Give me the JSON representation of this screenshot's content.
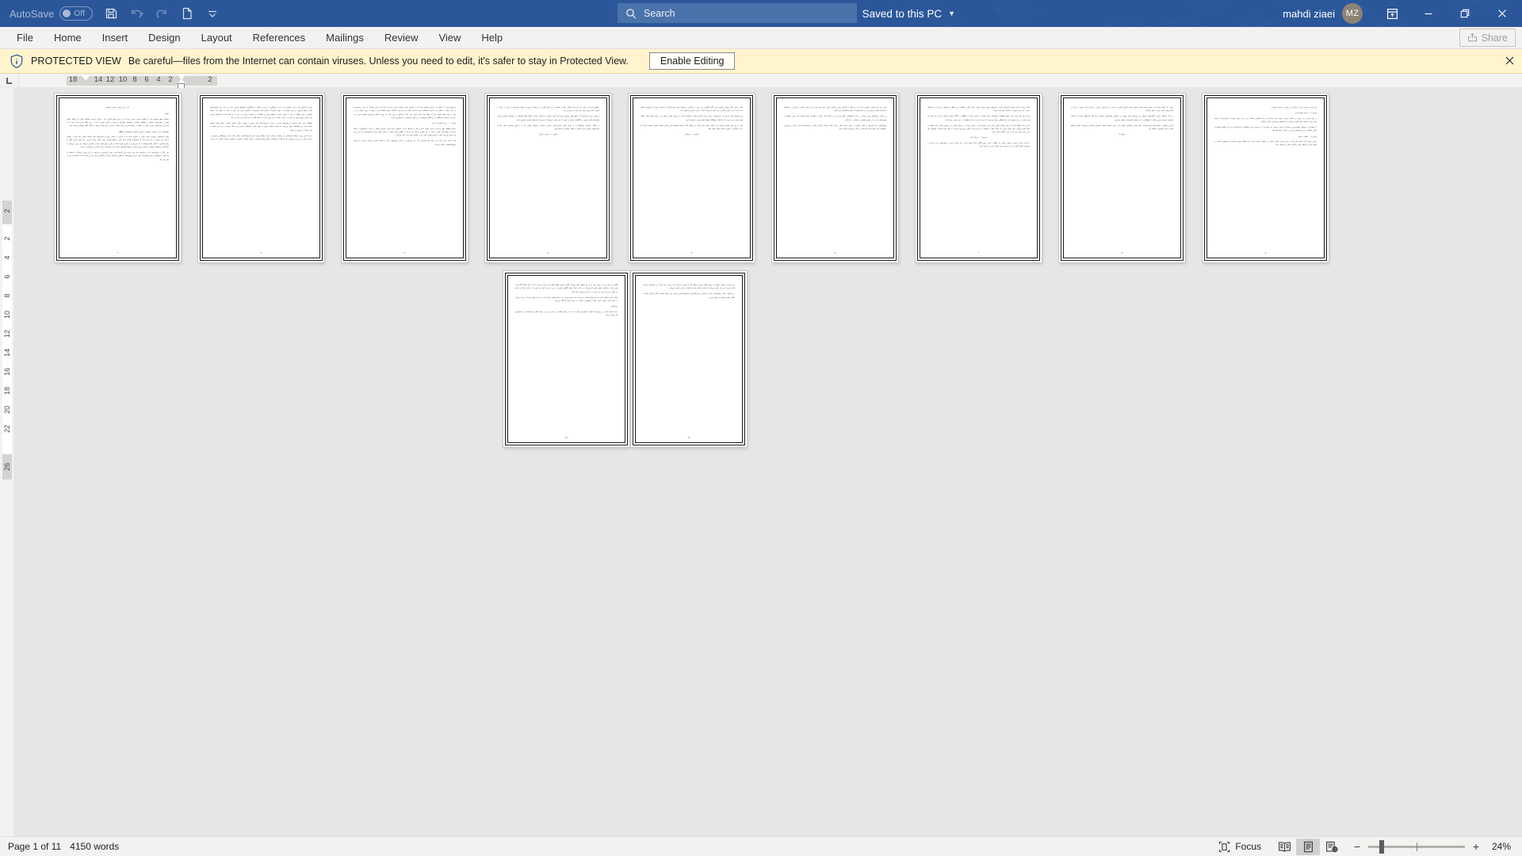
{
  "titlebar": {
    "autosave_label": "AutoSave",
    "autosave_state": "Off",
    "icons": {
      "save": "save-icon",
      "undo": "undo-icon",
      "redo": "redo-icon",
      "new": "new-document-icon",
      "customize": "customize-quick-access-toolbar-icon"
    },
    "document_name": "تازه ترین رویکرد درمانی اوتیسم",
    "separator1": "-",
    "protected_view_label": "Protected View",
    "separator2": "-",
    "saved_state": "Saved to this PC",
    "user_name": "mahdi ziaei",
    "user_initials": "MZ",
    "ribbon_display_icon": "ribbon-display-options-icon",
    "minimize_icon": "minimize-icon",
    "restore_icon": "restore-icon",
    "close_icon": "close-icon",
    "accent_color": "#2b579a"
  },
  "search": {
    "icon": "search-icon",
    "placeholder": "Search",
    "value": "Search"
  },
  "ribbon": {
    "tabs": [
      {
        "label": "File"
      },
      {
        "label": "Home"
      },
      {
        "label": "Insert"
      },
      {
        "label": "Design"
      },
      {
        "label": "Layout"
      },
      {
        "label": "References"
      },
      {
        "label": "Mailings"
      },
      {
        "label": "Review"
      },
      {
        "label": "View"
      },
      {
        "label": "Help"
      }
    ],
    "share_label": "Share",
    "share_icon": "share-icon",
    "share_disabled": true
  },
  "protected_view": {
    "icon": "shield-info-icon",
    "title": "PROTECTED VIEW",
    "message": "Be careful—files from the Internet can contain viruses. Unless you need to edit, it's safer to stay in Protected View.",
    "button_label": "Enable Editing",
    "close_icon": "close-icon",
    "background_color": "#fff4ce"
  },
  "ruler": {
    "tab_stop_label": "L",
    "horizontal_numbers": [
      "18",
      "14",
      "12",
      "10",
      "8",
      "6",
      "4",
      "2",
      "2"
    ],
    "vertical_numbers": [
      "2",
      "2",
      "4",
      "6",
      "8",
      "10",
      "12",
      "14",
      "16",
      "18",
      "20",
      "22",
      "26"
    ]
  },
  "status_bar": {
    "page_label": "Page 1 of 11",
    "word_count": "4150 words",
    "focus_label": "Focus",
    "focus_icon": "focus-mode-icon",
    "read_mode_icon": "read-mode-icon",
    "print_layout_icon": "print-layout-icon",
    "web_layout_icon": "web-layout-icon",
    "active_view": "print-layout",
    "zoom_out_label": "−",
    "zoom_in_label": "+",
    "zoom_percent": "24%"
  },
  "document": {
    "zoom": 24,
    "page_count": 11,
    "current_page": 1,
    "pages": [
      {
        "number": "1",
        "blocks": [
          {
            "style": "h",
            "text": "تازه ترین رویکرد درمانی اوتیسم"
          },
          {
            "style": "sec",
            "text": "چکیده:"
          },
          {
            "style": "p",
            "text": "اختلالات طیف اوتیسم یکی از اختلالات عصبی رشدی است که در سنین اولیه کودکی خود را نشان می‌دهد. مشکلات اصلی این اختلال شامل نقص در مهارت‌های ارتباطی و تعاملات اجتماعی، رفتارهای کلیشه‌ای و محدود و علایق تکراری است. در این مقاله سعی شده است که به تازه‌ترین رویکردهای درمانی مبتنی بر شواهد از روان‌شناسی و علوم اعصاب شناختی برای کودکان مبتلا به اختلال طیف اوتیسم پرداخته شود."
          },
          {
            "style": "sec",
            "text": "راهکارهای کار با کودکان اوتیسم از طریق مداخلات روانشناختی (ABA)"
          },
          {
            "style": "p",
            "text": "روش آنه‌سالیوان رویکردی علمی مبتنی بر یادگیری است که با تمرکز بر سنجش رفتار و توانایی‌های قابل توسعه، مسیر رشد کودک را هموار می‌کند. این رویکرد بر این باور است که رفتارهای کودکان قابل تغییر و اصلاح هستند. روش تحلیل رفتار کاربردی برای بهبود تمرکز، گفتار و رفتار کودکان با اختلال طیف اوتیسم به کار می‌رود و از طریق تقویت مثبت و تکرار، مهارت‌های جدید را آموزش می‌دهد. این روش می‌تواند به شکل‌گیری ارتباطات عمیق‌تر و پایدارتر میان کودک و محیط اطرافش کمک کند و زمینه‌ساز رشد شناختی و اجتماعی او باشد."
          },
          {
            "style": "p",
            "text": "یکی دیگر از رویکردهایی که در سال‌های اخیر مورد توجه قرار گرفته است، روش بازی‌درمانی می‌باشد. در این روش، درمانگر با استفاده از بازی‌های ساختاریافته و غیرساختاریافته سعی می‌کند مهارت‌های ارتباطی و تعاملی کودک را گسترش دهد و به او کمک کند تا احساسات خود را بهتر بیان کند."
          }
        ]
      },
      {
        "number": "2",
        "blocks": [
          {
            "style": "p",
            "text": "روش آنه‌سالیوان یک حرکت تخصصی است که با بهره‌گیری از حرکت و قصد در شکل‌گیری شبکه‌های عصبی، زمینه را برای رشد توانمندی‌های کودک فراهم می‌آورد. در مورد هم‌زمان به عنوان موجودات انسانی قادر می‌باشیم به یادگیری کردن حال مبتنی از افراد به عنوان یک سیستم مکانیکی یا این نیروگاه، از قرار به عنوان عوض و سیستم مبتنی بر اطلاعات به واسطه حرکات سر، این به این معنا است که پتانسیل انسانی برای تغییر و تغییر بهبود در تمرکز به مراتب بیشتر از آن چیزی است که قبلاً انتظار به این شکل پای بودن آن بود."
          },
          {
            "style": "p",
            "text": "مطالعات اخیر نشان داده‌اند که روش‌های مبتنی بر حرکت، می‌توانند تأثیر قابل توجهی بر کیفیت زندگی کودکان مبتلا به اختلال طیف اوتیسم داشته باشند. این مطالعات نشان می‌دهند که تمرینات منظم حرکتی به بهبود تعادل، هماهنگی و کنترل بدن کمک می‌کنند و در نتیجه اعتماد به نفس کودک را افزایش می‌دهند."
          },
          {
            "style": "p",
            "text": "در ارائه این روش توسط اندیشمندان در رابطه با کودکان دارای نیازهای ویژه، نتایج امیدوارکننده‌ای حاصل شده است. پژوهشگران بسیاری در سراسر جهان به بررسی اثربخشی این مداخلات پرداخته‌اند و گزارش‌های متعددی از بهبود عملکرد شناختی و اجتماعی کودکان منتشر شده است."
          }
        ]
      },
      {
        "number": "3",
        "blocks": [
          {
            "style": "p",
            "text": "و محیط است. آنه طیف یک حرکت تخصصی است که با کودکان دارای نیازهای خاص انجام داده است که عنوان کودکان از ترس و محدودیت در حال حرکت به معنای و از قدرت و تعاملات جدید شده‌اند، دیگر داخل کار یابد انشاالله نیروی هماهنگ کار در رابطه با روش اختلال سن در طی دو دهه شاهد تحولات کار آنه طیف بوده اینکه بسیار خود، نکات استدامها در این است که روش اختلالیه مبتدی‌ون منطقی خود برد و بخشی از آموزش دانشگاهی و برنامه‌های پژوهشی در پزشکی توانبخشی و فیزیوتراپی گردند."
          },
          {
            "style": "sec",
            "text": "مازوم ۱ — حرکت همراه با توجه"
          },
          {
            "style": "p",
            "text": "حرکت هماهنگ بهبود و قدرت زندگی انسان است و مغز به واسطه حرکت ساختمانی شده است. بنابراین مشکل به رشد و شکل‌گیری از کمک می‌کند در واقع مغز، تمامی حرکت را ساز ماهیتی می‌کند، اما حرکت به قطعی کافی نیست به عنوان مثال حرکت‌ هوشیارانه‌ای که چون توجه فرد انجام می‌شود یکجا از طریق مهارت هایی که در انگیزه وجود دارد ایجاد می‌گردد."
          },
          {
            "style": "p",
            "text": "مغز حرکت کردن علت می شود مغز تغییراتی یابد، این موضوع به ساختار نورون‌های جدید و ارتباط عصبی مربوط می‌شود که فرآیند نوروپلاستیسیتی نامیده می‌شود."
          }
        ]
      },
      {
        "number": "4",
        "blocks": [
          {
            "style": "p",
            "text": "راهنمایی است در مغز. ما قرار دهد کودکان مبتلا به اوتیسم را در نظر بگیرند، در رابطه با نوروز از منظر نورولوژیک و مبتنی بر رشد، از تأثیرات قابل روی تمرکز قابل توجه و بررسی دارد."
          },
          {
            "style": "p",
            "text": "مرحله‌ی سوم، مرحله‌ای که از مهارت‌های روزمره برای اجرا گردد. بسیاری از کودکان مبتلا به اختلال طیف اوتیسم، در سال‌های نخستین زندگی، تفاوت‌های قابل توجهی در الگوهای حرکتی و حسی از خود نشان می‌دهند که می‌تواند نشانه‌های اولیه‌ی تشخیص باشد."
          },
          {
            "style": "p",
            "text": "در مقابل، مداخلات زودهنگام که بر پایه‌ی اصول عصب‌شناختی طراحی شده‌اند، می‌توانند مسیر رشد را به طور معناداری تغییر دهند و فرصت‌های بیشتری برای یادگیری و تعامل اجتماعی فراهم آورند."
          },
          {
            "style": "ctr",
            "text": "مازوم ۲ — توجه و تمرکز"
          }
        ]
      },
      {
        "number": "5",
        "blocks": [
          {
            "style": "p",
            "text": "مغز در یکی دیگر نوعیات یادگیری است. نگاه یادگیری برای رشد و سازگاری در محیط است. مغز انسان از شبکه‌ای پیچیده از نورون‌ها تشکیل شده است که در طول زندگی و بر اساس تجربه‌ها، دائماً در حال بازسازی و تغییر است."
          },
          {
            "style": "p",
            "text": "این موضوع نشان می‌دهد که فرصت‌های درمانی برای کودکان مبتلا به اوتیسم محدود به دوره‌ی کودکی نیست و در تمام طول زندگی امکان بهبود وجود دارد، هرچند که مداخلات زودهنگام معمولاً نتایج بهتری به همراه دارند."
          },
          {
            "style": "p",
            "text": "آنچه در این میان اهمیت ویژه‌ای دارد، کیفیت تعامل میان کودک و درمانگر است. ارتباط عاطفی امن و قابل اعتماد، بستری فراهم می‌کند که در آن یادگیری به بهترین شکل ممکن اتفاق بیفتد."
          },
          {
            "style": "ctr",
            "text": "مازوم ۳ — یادگیری"
          }
        ]
      },
      {
        "number": "6",
        "blocks": [
          {
            "style": "p",
            "text": "مغز برای این نوعیات یادگیری است که در رابطه با کودکان دارای نیازهای خاص انجام داده است. این نکته‌ی کلیدی در طراحی برنامه‌های مداخله‌ای اهمیت فراوان دارد و باید همواره مد نظر متخصصان قرار گیرد."
          },
          {
            "style": "p",
            "text": "در نتیجه، رویکردهای نوین درمانی بر ایجاد محیط‌هایی تأکید دارند که در آن‌ها کودک بتواند با اطمینان خاطر کاوش کند، تجربه بیاموزد و مهارت‌های تازه را در بستری طبیعی و معنادار به کار گیرد."
          },
          {
            "style": "p",
            "text": "پژوهش‌های جدید همچنین بر نقش خانواده به عنوان شریک اصلی درمان تأکید می‌کنند. آموزش والدین و توانمندسازی آنان، یکی از مؤثرترین راهکارها برای تداوم اثرات مداخله در زندگی روزمره‌ی کودک است."
          }
        ]
      },
      {
        "number": "7",
        "blocks": [
          {
            "style": "p",
            "text": "کمک می‌کند حرکت تنها راه افزایش کارایی سلول‌های مغزی نیست. تغذیه، خواب کافی، فعالیت بدنی منظم و محیطی سرشار از محرک‌های مناسب نیز نقش مهمی در سلامت مغز ایفا می‌کنند."
          },
          {
            "style": "p",
            "text": "قدرت مغز تنها تکرار است. طبق مطالعات دانشمندان علوم اعصاب و تخمین حاصل از (HPA) و (HPT)، تمامی یافته‌ها حاکی از آن است که مغز انسان در برابر تغییرات از خود انعطاف نشان می‌دهد، که این امر یکی از دلایل مقاومت در برابر تغییر بوده است."
          },
          {
            "style": "p",
            "text": "از آن پیدا محفظه است که مغز کودکان طفل مرحله رشد عصبی‌حرکتی را طی می‌کند. در مرحله چهارم و در دوران کودکی قابت اتفاق در فضا شکل می‌گیرد، چهار تصور می‌کرد که کودک مبتلا به اوتیسم در این مرحله با تلاشی روزی‌رو می‌شود. به نظر کودک مبتلا به اوتیسم، مغز علی برقی وجود دارد که در حلی عملکرد اصلی باشد."
          },
          {
            "style": "ctr",
            "text": "مازوم ۴ — حرکت آزاد"
          },
          {
            "style": "p",
            "text": "با انجام حرکت سریع و شفاف، عصبی یک فعالیت حرکتی بدون آگاهی انجام گرفته است. برای نشانه شدن در مهارت‌های جدید و غلبه بر محدودیت اولین گامی که باید برداشته شود شکل کردن سر شده است."
          }
        ]
      },
      {
        "number": "8",
        "blocks": [
          {
            "style": "p",
            "text": "روشی که طیف مبتلا است فرصت مفید بسیار فراهم می‌کند. گرفتن فکری به ماده در کند قرامی حرکتی را داشته باشد ضمن به بخش از طراحی‌های علمی نوین به نظر کودکان."
          },
          {
            "style": "p",
            "text": "در کنار مداخلات فردی، فعالیت‌های گروهی نیز می‌توانند نقش مهمی در توسعه‌ی مهارت‌های اجتماعی ایفا کنند. گروه‌های کوچک با ساختار مشخص، فرصت تمرین تعامل با همسالان را در محیطی کنترل‌شده فراهم می‌آورند."
          },
          {
            "style": "p",
            "text": "ارزیابی مستمر و مستندسازی پیشرفت‌ها از دیگر ارکان برنامه‌های موفق است. بدون سنجش منظم، تشخیص اثربخشی روش‌ها و اصلاح به‌موقع مسیر درمان امکان‌پذیر نخواهد بود."
          },
          {
            "style": "ctr",
            "text": "مازوم ۵"
          }
        ]
      },
      {
        "number": "9",
        "blocks": [
          {
            "style": "p",
            "text": "اور زیان به عصبی برای بر شکل از در هدف به پیچیده می‌گردد."
          },
          {
            "style": "sec",
            "text": "مازوم ۶ — حرکت تعقیب‌کردن"
          },
          {
            "style": "p",
            "text": "در روند مغز در سر تجربه بر ساختار ارزش و مهارت کار، و قدرت و رشد مطلوبی یافته‌اند. آن در یک فرآیند پیوسته و طولانی‌مدت، ارتباط میان نواحی مختلف مغز تقویت می‌شود و کارکردهای پیچیده‌تری شکل می‌گیرند."
          },
          {
            "style": "p",
            "text": "با استفاده از ابزارهای تصویربرداری پیشرفته، امروزه می‌توان این تغییرات را به صورت عینی مشاهده و اندازه‌گیری کرد. این یافته‌ها پشتوانه‌ی علمی محکمی برای رویکردهای مبتنی بر حرکت فراهم آورده‌اند."
          },
          {
            "style": "sec",
            "text": "مازوم ۷ — تفکیک و تمایز"
          },
          {
            "style": "p",
            "text": "توجهی فوری گردد. اصل مغز است در پول عصبی شکلی سالم و در واقع با قدرت آن‌جا دارد. تفکیک دقیق محرک‌ها و پاسخ‌های مناسب به آن‌ها، یکی از پایه‌های اصلی یادگیری مؤثر در کودکان است."
          }
        ]
      },
      {
        "number": "10",
        "blocks": [
          {
            "style": "p",
            "text": "آگاهی به دانش فرد در مورد کنید که در هر لحظه انجام می‌شود. آگاهی داشتن نقطه مقابل غیر ارادی و آسیب است. اینکه کودک آگاه باشد یعنی مغز در واکنش سطح عمیق کار می‌کند و چه قدر کودک بتواند آگاهی بیشتری از بدن خود پیدا کند، هر کاری که به نظر کودک در انجام آن نظران می‌رسد مثل راه رفتن را به خوبی می‌تواند انجام دهد."
          },
          {
            "style": "p",
            "text": "کودک لمس مسائل است که هر کودکی ظفت به مرحله رشد عصبی‌حرکتی را به نظر انسان دریافت کند. کل فراز نیست کودک و پرتاب وسایل به سمت هدف خاصی، کودک مبتلا به اوتیسم را نسبت به حرکت نسبت ها آگاه می‌سازد."
          },
          {
            "style": "sec",
            "text": "نتیجه‌گیری"
          },
          {
            "style": "p",
            "text": "حرکت نقشه اصلی در رویکرد آنه طیف استدلال‌پذیر بسته است که در گونه فعالیت در داخل بدن دارد. جمله افکار و احساسات به ساختارهای مغز کمک می‌کند."
          }
        ]
      },
      {
        "number": "11",
        "blocks": [
          {
            "style": "p",
            "text": "دارد. مغز به شکلی استفاده از روش طیف فرصت فراهم کنند که عصبی ساخته شده و توجه رشد کودک در برنامه‌های روزمره ادامه می‌یابد. این امر نشان می‌دهد که اثرات مداخله تنها در جلسات درمانی محدود نمی‌ماند."
          },
          {
            "style": "p",
            "text": "در مجموع، ترکیب رویکردهای حرکتی، شناختی و خانواده‌محور، امیدوارکننده‌ترین مسیر برای بهبود کیفیت زندگی کودکان مبتلا به اختلال طیف اوتیسم به شمار می‌رود."
          }
        ]
      }
    ]
  }
}
